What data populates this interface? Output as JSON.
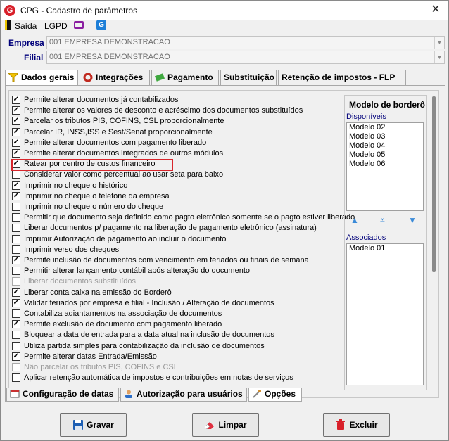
{
  "window": {
    "title": "CPG - Cadastro de parâmetros",
    "close": "✕"
  },
  "menu": {
    "saida": "Saída",
    "lgpd": "LGPD"
  },
  "fields": {
    "empresa_label": "Empresa",
    "empresa_value": "001 EMPRESA DEMONSTRACAO",
    "filial_label": "Filial",
    "filial_value": "001 EMPRESA DEMONSTRACAO"
  },
  "tabs": [
    "Dados gerais",
    "Integrações",
    "Pagamento",
    "Substituição",
    "Retenção de impostos - FLP"
  ],
  "options": [
    {
      "label": "Permite alterar documentos já contabilizados",
      "checked": true,
      "enabled": true
    },
    {
      "label": "Permite alterar os valores de desconto e acréscimo dos documentos substituídos",
      "checked": true,
      "enabled": true
    },
    {
      "label": "Parcelar os tributos PIS, COFINS, CSL proporcionalmente",
      "checked": true,
      "enabled": true
    },
    {
      "label": "Parcelar IR, INSS,ISS e Sest/Senat proporcionalmente",
      "checked": true,
      "enabled": true
    },
    {
      "label": "Permite alterar documentos com pagamento liberado",
      "checked": true,
      "enabled": true
    },
    {
      "label": "Permite alterar documentos integrados de outros módulos",
      "checked": true,
      "enabled": true
    },
    {
      "label": "Ratear por centro de custos financeiro",
      "checked": true,
      "enabled": true
    },
    {
      "label": "Considerar valor como percentual ao usar seta para baixo",
      "checked": false,
      "enabled": true
    },
    {
      "label": "Imprimir no cheque o histórico",
      "checked": true,
      "enabled": true
    },
    {
      "label": "Imprimir no cheque o telefone da empresa",
      "checked": true,
      "enabled": true
    },
    {
      "label": "Imprimir no cheque o número do cheque",
      "checked": false,
      "enabled": true
    },
    {
      "label": "Permitir que documento seja definido como pagto eletrônico somente se o pagto estiver liberado",
      "checked": false,
      "enabled": true
    },
    {
      "label": "Liberar documentos p/ pagamento na liberação de pagamento eletrônico (assinatura)",
      "checked": false,
      "enabled": true
    },
    {
      "label": "Imprimir Autorização de pagamento ao incluir o documento",
      "checked": false,
      "enabled": true
    },
    {
      "label": "Imprimir verso dos cheques",
      "checked": false,
      "enabled": true
    },
    {
      "label": "Permite inclusão de documentos com vencimento em feriados ou finais de semana",
      "checked": true,
      "enabled": true
    },
    {
      "label": "Permitir alterar lançamento contábil após alteração do documento",
      "checked": false,
      "enabled": true
    },
    {
      "label": "Liberar documentos substituídos",
      "checked": false,
      "enabled": false
    },
    {
      "label": "Liberar conta caixa na emissão do Borderô",
      "checked": true,
      "enabled": true
    },
    {
      "label": "Validar feriados por empresa e filial - Inclusão / Alteração de documentos",
      "checked": true,
      "enabled": true
    },
    {
      "label": "Contabiliza adiantamentos na associação de documentos",
      "checked": false,
      "enabled": true
    },
    {
      "label": "Permite exclusão de documento com pagamento liberado",
      "checked": true,
      "enabled": true
    },
    {
      "label": "Bloquear a data de entrada para a data atual na inclusão de documentos",
      "checked": false,
      "enabled": true
    },
    {
      "label": "Utiliza partida simples para contabilização da inclusão de documentos",
      "checked": false,
      "enabled": true
    },
    {
      "label": "Permite alterar datas Entrada/Emissão",
      "checked": true,
      "enabled": true
    },
    {
      "label": "Não parcelar os tributos PIS, COFINS e CSL",
      "checked": false,
      "enabled": false
    },
    {
      "label": "Aplicar retenção automática de impostos e contribuições em notas de serviços",
      "checked": false,
      "enabled": true
    }
  ],
  "modelo": {
    "title": "Modelo de borderô",
    "disponiveis_label": "Disponíveis",
    "disponiveis": [
      "Modelo 02",
      "Modelo 03",
      "Modelo 04",
      "Modelo 05",
      "Modelo 06"
    ],
    "associados_label": "Associados",
    "associados": [
      "Modelo 01"
    ]
  },
  "bottom_tabs": [
    "Configuração de datas",
    "Autorização para usuários",
    "Opções"
  ],
  "buttons": {
    "gravar": "Gravar",
    "limpar": "Limpar",
    "excluir": "Excluir"
  },
  "colors": {
    "label_blue": "#00007a",
    "highlight_red": "#d8262c",
    "list_link_blue": "#3a8ad8"
  }
}
